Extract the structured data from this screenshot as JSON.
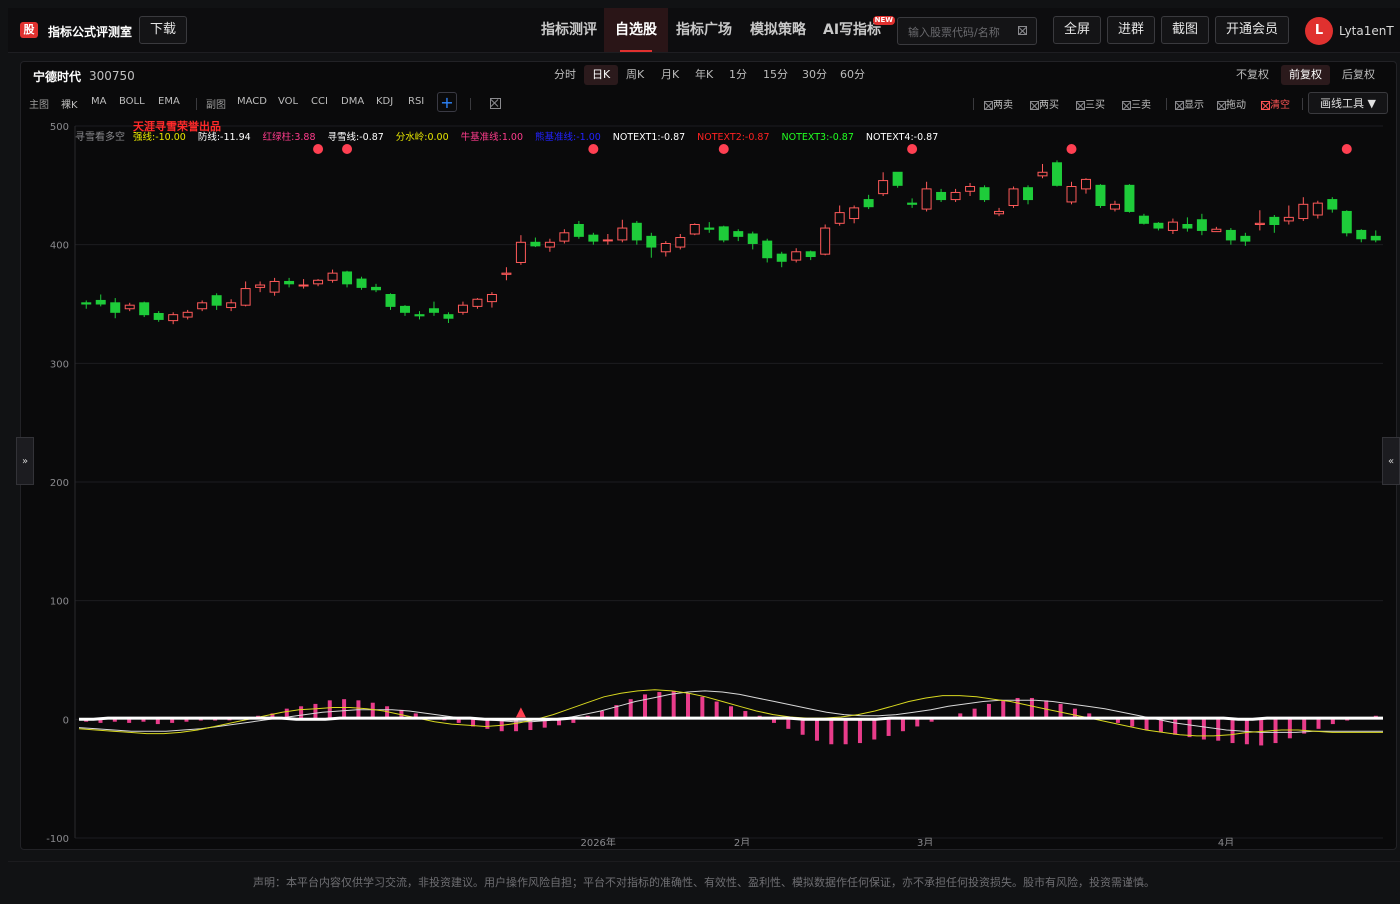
{
  "header": {
    "logo_char": "股",
    "app_title": "指标公式评测室",
    "download_label": "下载",
    "nav": [
      {
        "label": "指标测评",
        "active": false
      },
      {
        "label": "自选股",
        "active": true
      },
      {
        "label": "指标广场",
        "active": false
      },
      {
        "label": "模拟策略",
        "active": false
      },
      {
        "label": "AI写指标",
        "active": false,
        "badge": "NEW"
      }
    ],
    "search": {
      "placeholder": "输入股票代码/名称",
      "value": ""
    },
    "buttons": {
      "fullscreen": "全屏",
      "join_group": "进群",
      "screenshot": "截图",
      "membership": "开通会员"
    },
    "user": {
      "avatar_letter": "L",
      "name": "Lyta1enT"
    }
  },
  "stock": {
    "name": "宁德时代",
    "code": "300750"
  },
  "periods": [
    {
      "label": "分时",
      "active": false
    },
    {
      "label": "日K",
      "active": true
    },
    {
      "label": "周K",
      "active": false
    },
    {
      "label": "月K",
      "active": false
    },
    {
      "label": "年K",
      "active": false
    },
    {
      "label": "1分",
      "active": false
    },
    {
      "label": "15分",
      "active": false
    },
    {
      "label": "30分",
      "active": false
    },
    {
      "label": "60分",
      "active": false
    }
  ],
  "adjust": [
    {
      "label": "不复权",
      "active": false
    },
    {
      "label": "前复权",
      "active": true
    },
    {
      "label": "后复权",
      "active": false
    }
  ],
  "indicator_toolbar": {
    "main_label": "主图",
    "main_items": [
      "裸K",
      "MA",
      "BOLL",
      "EMA"
    ],
    "sub_label": "副图",
    "sub_items": [
      "MACD",
      "VOL",
      "CCI",
      "DMA",
      "KDJ",
      "RSI"
    ],
    "add_label": "+"
  },
  "signal_filters": [
    {
      "label": "两卖",
      "red": false
    },
    {
      "label": "两买",
      "red": false
    },
    {
      "label": "三买",
      "red": false
    },
    {
      "label": "三卖",
      "red": false
    },
    {
      "label": "显示",
      "red": false
    },
    {
      "label": "拖动",
      "red": false
    },
    {
      "label": "清空",
      "red": true
    }
  ],
  "draw_tools_label": "画线工具 ▼",
  "side": {
    "left": "»",
    "right": "«"
  },
  "overlay": {
    "watermark": "天涯寻雪荣誉出品",
    "indicator_name": "寻雪看多空",
    "legend": [
      {
        "text": "强线:-10.00",
        "color": "#e6e600"
      },
      {
        "text": "防线:-11.94",
        "color": "#ffffff"
      },
      {
        "text": "红绿柱:3.88",
        "color": "#ff3c8c"
      },
      {
        "text": "寻雪线:-0.87",
        "color": "#ffffff"
      },
      {
        "text": "分水岭:0.00",
        "color": "#e6e600"
      },
      {
        "text": "牛基准线:1.00",
        "color": "#ff3c8c"
      },
      {
        "text": "熊基准线:-1.00",
        "color": "#2222ff"
      },
      {
        "text": "NOTEXT1:-0.87",
        "color": "#ffffff"
      },
      {
        "text": "NOTEXT2:-0.87",
        "color": "#ff2222"
      },
      {
        "text": "NOTEXT3:-0.87",
        "color": "#22ff22"
      },
      {
        "text": "NOTEXT4:-0.87",
        "color": "#ffffff"
      }
    ]
  },
  "footer": {
    "disclaimer": "声明：本平台内容仅供学习交流，非投资建议。用户操作风险自担；平台不对指标的准确性、有效性、盈利性、模拟数据作任何保证，亦不承担任何投资损失。股市有风险，投资需谨慎。"
  },
  "chart_data": {
    "type": "candlestick",
    "y_ticks": [
      500,
      400,
      300,
      200,
      100,
      0,
      -100
    ],
    "ylim": [
      -100,
      500
    ],
    "x_labels": [
      "2026年",
      "2月",
      "3月",
      "4月"
    ],
    "x_label_positions": [
      40,
      51,
      65,
      88
    ],
    "up_color": "#ff5a5a",
    "down_color": "#1ecc3a",
    "candles": [
      [
        351,
        350,
        353,
        346
      ],
      [
        353,
        350,
        358,
        348
      ],
      [
        351,
        343,
        355,
        338
      ],
      [
        346,
        349,
        351,
        344
      ],
      [
        351,
        341,
        352,
        339
      ],
      [
        342,
        337,
        344,
        335
      ],
      [
        336,
        341,
        343,
        333
      ],
      [
        339,
        343,
        345,
        337
      ],
      [
        346,
        351,
        353,
        344
      ],
      [
        357,
        349,
        359,
        345
      ],
      [
        347,
        351,
        354,
        344
      ],
      [
        349,
        363,
        369,
        348
      ],
      [
        364,
        366,
        369,
        360
      ],
      [
        360,
        369,
        372,
        357
      ],
      [
        369,
        367,
        372,
        364
      ],
      [
        366,
        366,
        371,
        363
      ],
      [
        367,
        370,
        371,
        365
      ],
      [
        370,
        376,
        379,
        368
      ],
      [
        377,
        367,
        378,
        364
      ],
      [
        371,
        364,
        373,
        362
      ],
      [
        364,
        362,
        367,
        360
      ],
      [
        358,
        348,
        359,
        345
      ],
      [
        348,
        343,
        349,
        340
      ],
      [
        341,
        340,
        344,
        337
      ],
      [
        346,
        343,
        352,
        340
      ],
      [
        341,
        338,
        343,
        334
      ],
      [
        343,
        349,
        352,
        341
      ],
      [
        348,
        354,
        355,
        346
      ],
      [
        352,
        358,
        360,
        347
      ],
      [
        375,
        376,
        381,
        370
      ],
      [
        385,
        402,
        408,
        383
      ],
      [
        402,
        399,
        406,
        398
      ],
      [
        398,
        402,
        405,
        394
      ],
      [
        403,
        410,
        413,
        401
      ],
      [
        417,
        407,
        420,
        405
      ],
      [
        408,
        403,
        410,
        400
      ],
      [
        404,
        404,
        409,
        400
      ],
      [
        404,
        414,
        421,
        402
      ],
      [
        418,
        404,
        420,
        400
      ],
      [
        407,
        398,
        410,
        389
      ],
      [
        394,
        401,
        403,
        390
      ],
      [
        398,
        406,
        409,
        396
      ],
      [
        409,
        417,
        418,
        408
      ],
      [
        414,
        413,
        419,
        410
      ],
      [
        415,
        404,
        416,
        402
      ],
      [
        411,
        407,
        413,
        403
      ],
      [
        409,
        401,
        411,
        396
      ],
      [
        403,
        389,
        405,
        385
      ],
      [
        392,
        386,
        394,
        381
      ],
      [
        387,
        394,
        397,
        385
      ],
      [
        394,
        390,
        395,
        387
      ],
      [
        392,
        414,
        417,
        391
      ],
      [
        418,
        427,
        433,
        416
      ],
      [
        422,
        431,
        433,
        418
      ],
      [
        438,
        432,
        442,
        430
      ],
      [
        443,
        454,
        461,
        441
      ],
      [
        461,
        450,
        461,
        448
      ],
      [
        435,
        434,
        439,
        431
      ],
      [
        430,
        447,
        453,
        428
      ],
      [
        444,
        438,
        447,
        436
      ],
      [
        438,
        444,
        447,
        436
      ],
      [
        445,
        449,
        452,
        441
      ],
      [
        448,
        438,
        450,
        436
      ],
      [
        426,
        428,
        431,
        424
      ],
      [
        433,
        447,
        449,
        431
      ],
      [
        448,
        438,
        450,
        434
      ],
      [
        458,
        461,
        468,
        456
      ],
      [
        469,
        450,
        471,
        449
      ],
      [
        436,
        449,
        453,
        434
      ],
      [
        447,
        455,
        456,
        443
      ],
      [
        450,
        433,
        451,
        431
      ],
      [
        430,
        434,
        437,
        428
      ],
      [
        450,
        428,
        451,
        427
      ],
      [
        424,
        418,
        426,
        417
      ],
      [
        418,
        414,
        419,
        412
      ],
      [
        412,
        419,
        422,
        409
      ],
      [
        417,
        414,
        423,
        411
      ],
      [
        421,
        412,
        426,
        408
      ],
      [
        411,
        413,
        415,
        411
      ],
      [
        412,
        404,
        414,
        400
      ],
      [
        407,
        403,
        410,
        399
      ],
      [
        417,
        418,
        429,
        412
      ],
      [
        423,
        417,
        425,
        410
      ],
      [
        420,
        423,
        433,
        417
      ],
      [
        422,
        434,
        440,
        420
      ],
      [
        425,
        435,
        437,
        422
      ],
      [
        438,
        430,
        440,
        427
      ],
      [
        428,
        410,
        429,
        407
      ],
      [
        412,
        405,
        413,
        402
      ],
      [
        407,
        404,
        412,
        402
      ]
    ],
    "signal_dots": [
      16,
      18,
      35,
      44,
      57,
      68,
      87
    ],
    "sub_hist": [
      -2,
      -3,
      -2,
      -3,
      -2,
      -4,
      -3,
      -2,
      -1,
      -1,
      0,
      1,
      3,
      5,
      9,
      11,
      13,
      16,
      17,
      16,
      14,
      11,
      8,
      5,
      2,
      0,
      -3,
      -6,
      -8,
      -10,
      -10,
      -9,
      -7,
      -5,
      -3,
      3,
      7,
      12,
      17,
      21,
      23,
      24,
      22,
      19,
      15,
      11,
      7,
      3,
      -3,
      -8,
      -13,
      -18,
      -21,
      -21,
      -20,
      -17,
      -14,
      -10,
      -6,
      -2,
      2,
      5,
      9,
      13,
      16,
      18,
      18,
      16,
      13,
      9,
      5,
      2,
      -3,
      -6,
      -9,
      -11,
      -13,
      -15,
      -17,
      -18,
      -20,
      -21,
      -22,
      -20,
      -16,
      -12,
      -8,
      -4,
      -1,
      1,
      3
    ],
    "sub_yellow": [
      -8,
      -9,
      -10,
      -11,
      -12,
      -12,
      -11,
      -9,
      -6,
      -3,
      0,
      3,
      6,
      8,
      9,
      10,
      10,
      9,
      7,
      4,
      1,
      -2,
      -4,
      -5,
      -6,
      -5,
      -3,
      0,
      4,
      9,
      14,
      19,
      22,
      24,
      25,
      24,
      22,
      19,
      15,
      11,
      7,
      4,
      2,
      1,
      1,
      2,
      4,
      7,
      11,
      15,
      18,
      20,
      20,
      19,
      17,
      15,
      12,
      9,
      6,
      3,
      0,
      -3,
      -6,
      -9,
      -11,
      -13,
      -14,
      -14,
      -13,
      -11,
      -10,
      -9,
      -9,
      -10,
      -11,
      -11,
      -11,
      -11
    ],
    "sub_white": [
      -7,
      -8,
      -9,
      -10,
      -10,
      -10,
      -9,
      -8,
      -6,
      -4,
      -2,
      0,
      2,
      4,
      6,
      7,
      8,
      8,
      8,
      7,
      5,
      3,
      1,
      0,
      -1,
      -2,
      -2,
      -1,
      1,
      4,
      7,
      11,
      15,
      18,
      21,
      23,
      24,
      23,
      21,
      18,
      15,
      12,
      9,
      6,
      4,
      3,
      3,
      4,
      6,
      8,
      11,
      13,
      15,
      16,
      16,
      16,
      15,
      13,
      11,
      9,
      6,
      3,
      0,
      -3,
      -5,
      -7,
      -9,
      -10,
      -11,
      -11,
      -11,
      -10,
      -10,
      -10,
      -10,
      -10
    ],
    "sub_thick": [
      0,
      0,
      1,
      1,
      1,
      1,
      1,
      1,
      1,
      1,
      1,
      1,
      1,
      1,
      1,
      0,
      0,
      0,
      1,
      1,
      1,
      1,
      1,
      1,
      1,
      1,
      1,
      1,
      0,
      0,
      0,
      0,
      0,
      0,
      1,
      1,
      1,
      1,
      1,
      1,
      1,
      1,
      1,
      1,
      1,
      1,
      1,
      1,
      1,
      1,
      0,
      0,
      0,
      0,
      0,
      0,
      1,
      1,
      1,
      1,
      1,
      1,
      1,
      1,
      1,
      1,
      1,
      1,
      1,
      1,
      1,
      1,
      1,
      1,
      1,
      1,
      1,
      1,
      1,
      1,
      0,
      0,
      1,
      1,
      1,
      1,
      1,
      1,
      1,
      1,
      1
    ]
  }
}
